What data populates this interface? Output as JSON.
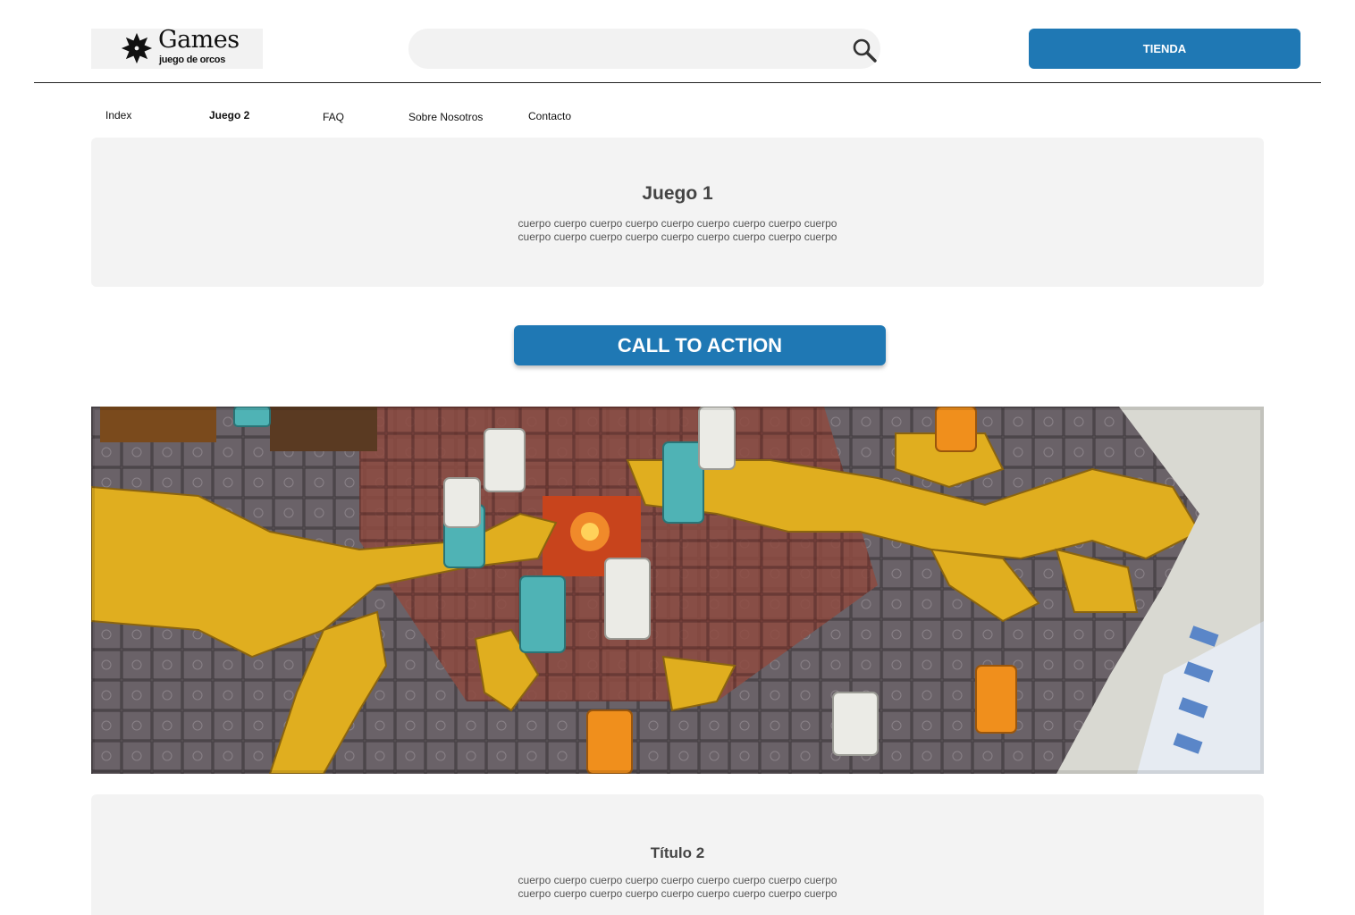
{
  "header": {
    "logo": {
      "title": "Games",
      "subtitle": "juego de orcos"
    },
    "search": {
      "value": "",
      "placeholder": ""
    },
    "store_button": "TIENDA"
  },
  "nav": {
    "items": [
      {
        "label": "Index",
        "active": false
      },
      {
        "label": "Juego 2",
        "active": true
      },
      {
        "label": "FAQ",
        "active": false
      },
      {
        "label": "Sobre Nosotros",
        "active": false
      },
      {
        "label": "Contacto",
        "active": false
      }
    ]
  },
  "section1": {
    "title": "Juego 1",
    "body_line1": "cuerpo cuerpo cuerpo cuerpo cuerpo cuerpo  cuerpo cuerpo cuerpo",
    "body_line2": "cuerpo cuerpo cuerpo cuerpo cuerpo cuerpo cuerpo cuerpo cuerpo"
  },
  "cta": {
    "label": "CALL TO ACTION"
  },
  "section2": {
    "title": "Título 2",
    "body_line1": "cuerpo cuerpo cuerpo cuerpo cuerpo cuerpo  cuerpo cuerpo cuerpo",
    "body_line2": "cuerpo cuerpo cuerpo cuerpo cuerpo cuerpo cuerpo cuerpo cuerpo"
  },
  "colors": {
    "accent": "#1f78b4",
    "card_bg": "#f3f3f3",
    "search_bg": "#f2f2f2"
  },
  "icons": {
    "logo": "flower-logo-icon",
    "search": "search-icon"
  }
}
